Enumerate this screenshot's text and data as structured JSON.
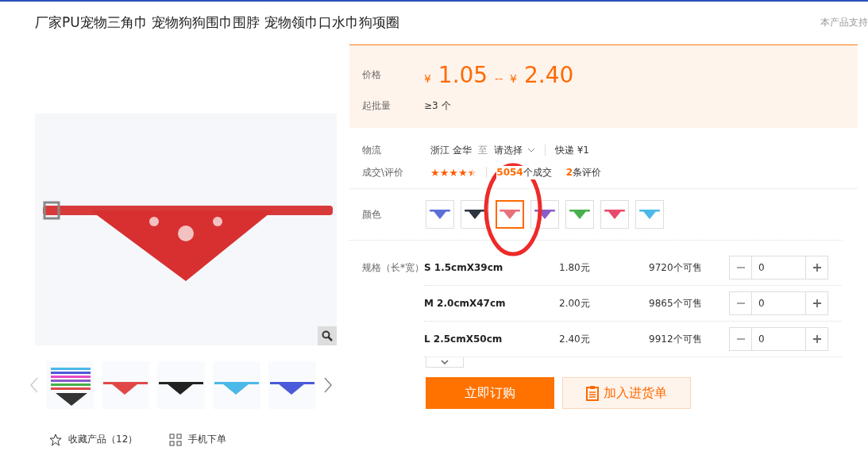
{
  "title": "厂家PU宠物三角巾 宠物狗狗围巾围脖 宠物领巾口水巾狗项圈",
  "support_note": "本产品支持",
  "price": {
    "label": "价格",
    "currency_low": "¥",
    "low": "1.05",
    "separator": "--",
    "currency_high": "¥",
    "high": "2.40"
  },
  "min_order": {
    "label": "起批量",
    "value": "≥3 个"
  },
  "logistics": {
    "label": "物流",
    "from": "浙江 金华",
    "to_word": "至",
    "destination": "请选择",
    "shipping": "快递",
    "fee": "¥1"
  },
  "deals": {
    "label": "成交\\评价",
    "stars": 4.5,
    "count": "5054",
    "count_suffix": "个成交",
    "reviews": "2",
    "reviews_suffix": "条评价"
  },
  "colors": {
    "label": "颜色",
    "swatches": [
      {
        "color": "#5a6fd8",
        "selected": false
      },
      {
        "color": "#2e3440",
        "selected": false
      },
      {
        "color": "#e8707a",
        "selected": true
      },
      {
        "color": "#8a5cc8",
        "selected": false
      },
      {
        "color": "#48b04c",
        "selected": false
      },
      {
        "color": "#e84a6a",
        "selected": false
      },
      {
        "color": "#4ab8e8",
        "selected": false
      }
    ]
  },
  "sizes": {
    "label": "规格（长*宽）",
    "rows": [
      {
        "name": "S 1.5cmX39cm",
        "price": "1.80元",
        "stock": "9720个可售",
        "qty": "0"
      },
      {
        "name": "M 2.0cmX47cm",
        "price": "2.00元",
        "stock": "9865个可售",
        "qty": "0"
      },
      {
        "name": "L 2.5cmX50cm",
        "price": "2.40元",
        "stock": "9912个可售",
        "qty": "0"
      }
    ]
  },
  "buttons": {
    "buy": "立即订购",
    "cart": "加入进货单"
  },
  "favorite": {
    "label": "收藏产品（12）"
  },
  "mobile_order": {
    "label": "手机下单"
  }
}
